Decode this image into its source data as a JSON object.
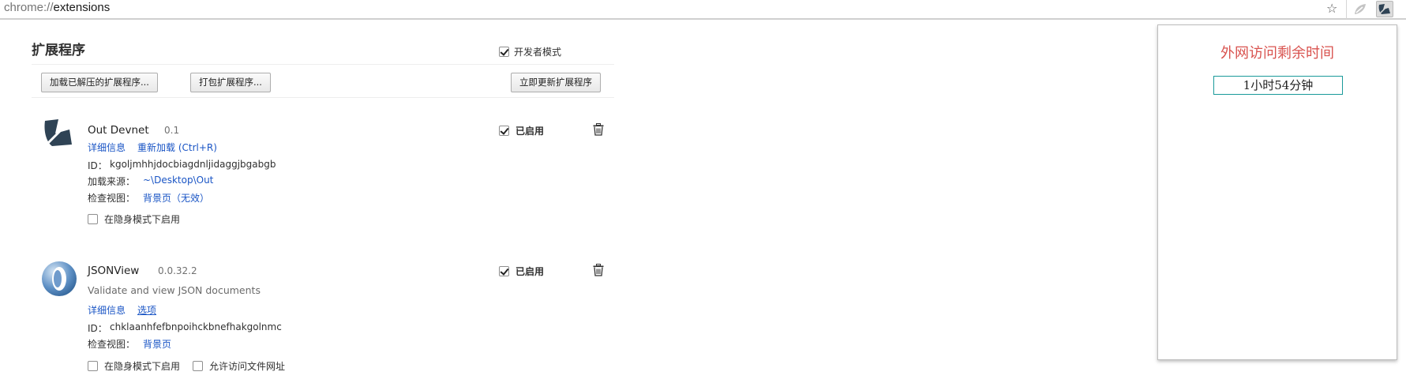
{
  "address_bar": {
    "scheme": "chrome://",
    "path": "extensions"
  },
  "toolbar": {
    "star_icon": "star-icon",
    "extensions": [
      "out-devnet-gray-icon",
      "out-devnet-active-icon"
    ]
  },
  "page": {
    "title": "扩展程序",
    "developer_mode_label": "开发者模式",
    "developer_mode_checked": true,
    "buttons": {
      "load_unpacked": "加载已解压的扩展程序...",
      "pack": "打包扩展程序...",
      "update_now": "立即更新扩展程序"
    }
  },
  "extensions": [
    {
      "name": "Out Devnet",
      "version": "0.1",
      "links": {
        "details": "详细信息",
        "reload": "重新加载 (Ctrl+R)"
      },
      "id_label": "ID：",
      "id_value": "kgoljmhhjdocbiagdnljidaggjbgabgb",
      "source_label": "加载来源：",
      "source_value": "~\\Desktop\\Out",
      "inspect_label": "检查视图：",
      "inspect_link": "背景页（无效）",
      "incognito_label": "在隐身模式下启用",
      "incognito_checked": false,
      "enabled_label": "已启用",
      "enabled": true
    },
    {
      "name": "JSONView",
      "version": "0.0.32.2",
      "description": "Validate and view JSON documents",
      "links": {
        "details": "详细信息",
        "options": "选项"
      },
      "id_label": "ID：",
      "id_value": "chklaanhfefbnpoihckbnefhakgolnmc",
      "inspect_label": "检查视图：",
      "inspect_link": "背景页",
      "incognito_label": "在隐身模式下启用",
      "incognito_checked": false,
      "file_access_label": "允许访问文件网址",
      "file_access_checked": false,
      "enabled_label": "已启用",
      "enabled": true
    }
  ],
  "popup": {
    "title": "外网访问剩余时间",
    "remaining": "1小时54分钟",
    "title_color": "#d9534f",
    "box_border_color": "#1a9a9a"
  },
  "colors": {
    "link": "#1a55c5",
    "text": "#303030"
  }
}
